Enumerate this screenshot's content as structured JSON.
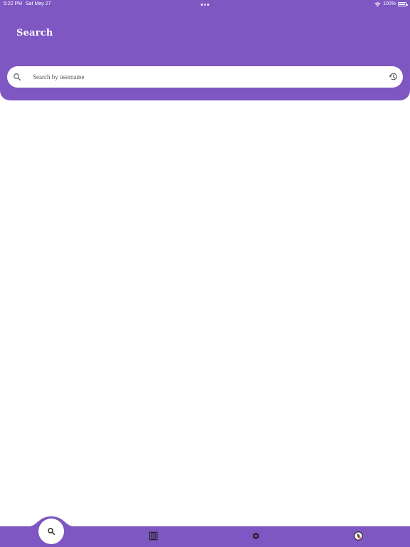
{
  "status_bar": {
    "time": "5:22 PM",
    "date": "Sat May 27",
    "battery": "100%"
  },
  "header": {
    "title": "Search"
  },
  "search": {
    "placeholder": "Search by username",
    "value": ""
  },
  "bottom_nav": {
    "items": [
      {
        "icon": "search-icon",
        "active": true
      },
      {
        "icon": "qr-code-icon",
        "active": false
      },
      {
        "icon": "gear-icon",
        "active": false
      },
      {
        "icon": "profile-avatar-icon",
        "active": false
      }
    ]
  },
  "colors": {
    "accent": "#7e57c2",
    "background": "#ffffff"
  }
}
